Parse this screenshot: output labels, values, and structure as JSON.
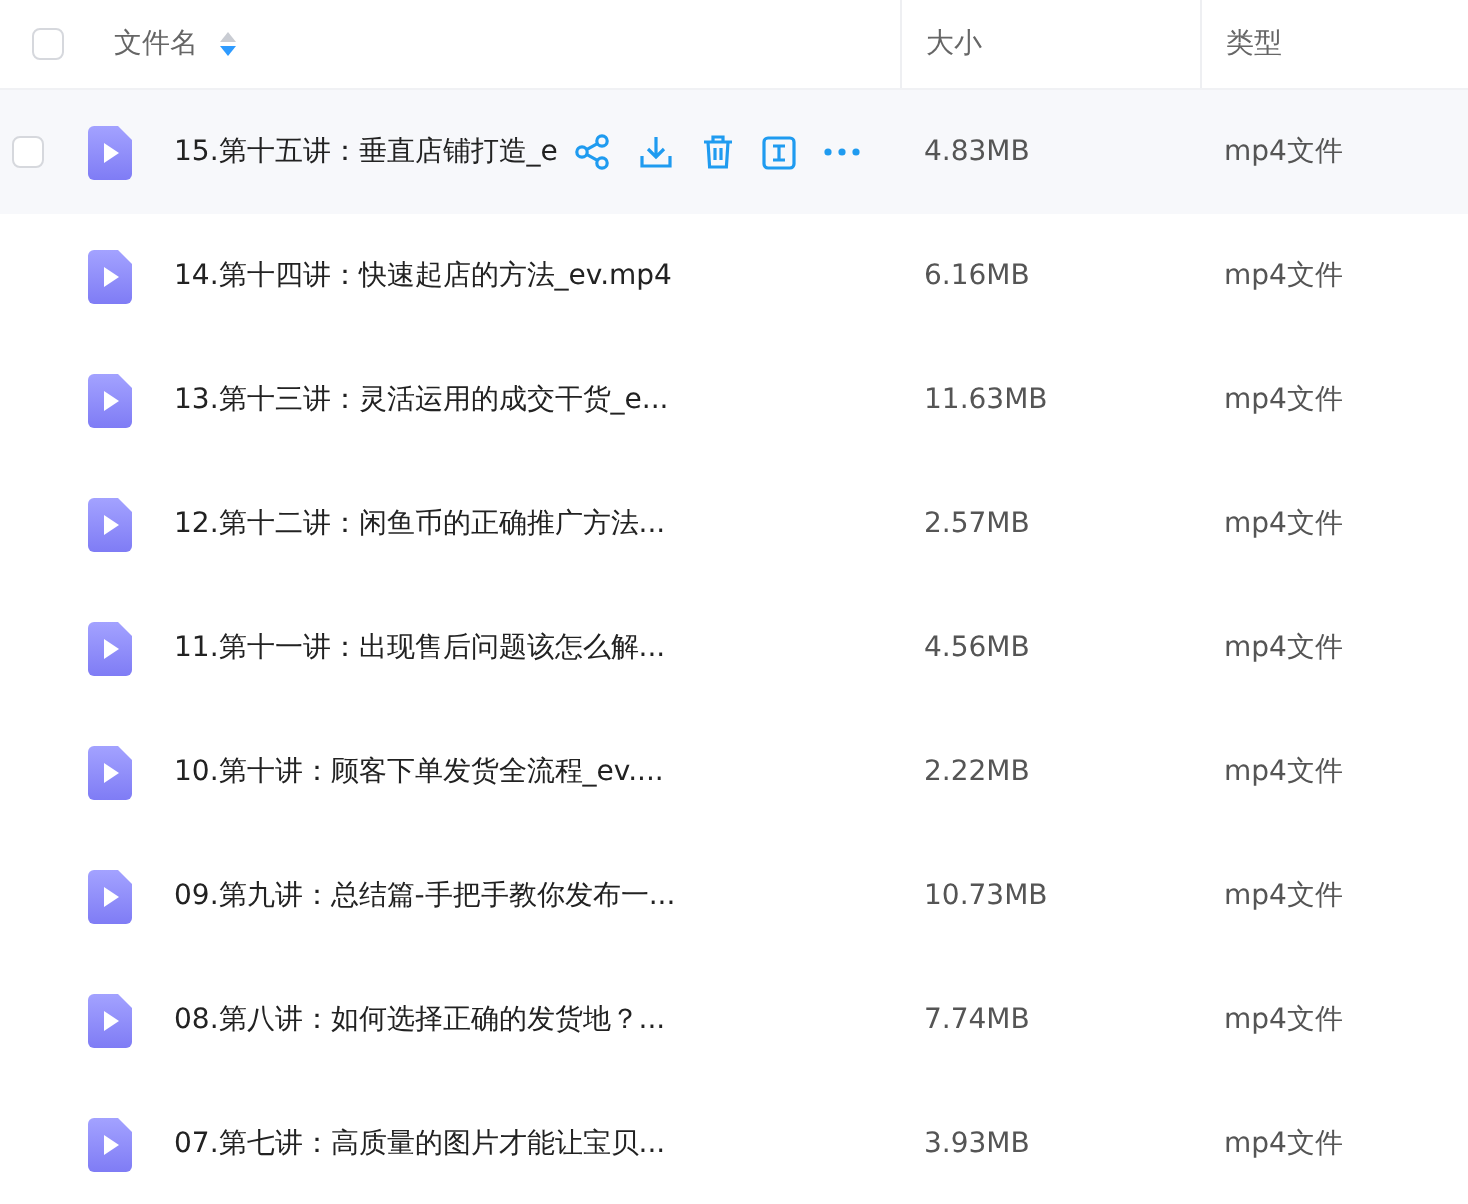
{
  "header": {
    "checked": false,
    "columns": [
      {
        "kind": "name",
        "label": "文件名",
        "sort_descending": true
      },
      {
        "kind": "size",
        "label": "大小"
      },
      {
        "kind": "type",
        "label": "类型"
      }
    ]
  },
  "rows": [
    {
      "name": "15.第十五讲：垂直店铺打造_e",
      "size": "4.83MB",
      "type": "mp4文件",
      "hovered": true,
      "checked": false
    },
    {
      "name": "14.第十四讲：快速起店的方法_ev.mp4",
      "size": "6.16MB",
      "type": "mp4文件",
      "hovered": false,
      "checked": false
    },
    {
      "name": "13.第十三讲：灵活运用的成交干货_e...",
      "size": "11.63MB",
      "type": "mp4文件",
      "hovered": false,
      "checked": false
    },
    {
      "name": "12.第十二讲：闲鱼币的正确推广方法...",
      "size": "2.57MB",
      "type": "mp4文件",
      "hovered": false,
      "checked": false
    },
    {
      "name": "11.第十一讲：出现售后问题该怎么解...",
      "size": "4.56MB",
      "type": "mp4文件",
      "hovered": false,
      "checked": false
    },
    {
      "name": "10.第十讲：顾客下单发货全流程_ev....",
      "size": "2.22MB",
      "type": "mp4文件",
      "hovered": false,
      "checked": false
    },
    {
      "name": "09.第九讲：总结篇-手把手教你发布一...",
      "size": "10.73MB",
      "type": "mp4文件",
      "hovered": false,
      "checked": false
    },
    {
      "name": "08.第八讲：如何选择正确的发货地？...",
      "size": "7.74MB",
      "type": "mp4文件",
      "hovered": false,
      "checked": false
    },
    {
      "name": "07.第七讲：高质量的图片才能让宝贝...",
      "size": "3.93MB",
      "type": "mp4文件",
      "hovered": false,
      "checked": false
    }
  ]
}
